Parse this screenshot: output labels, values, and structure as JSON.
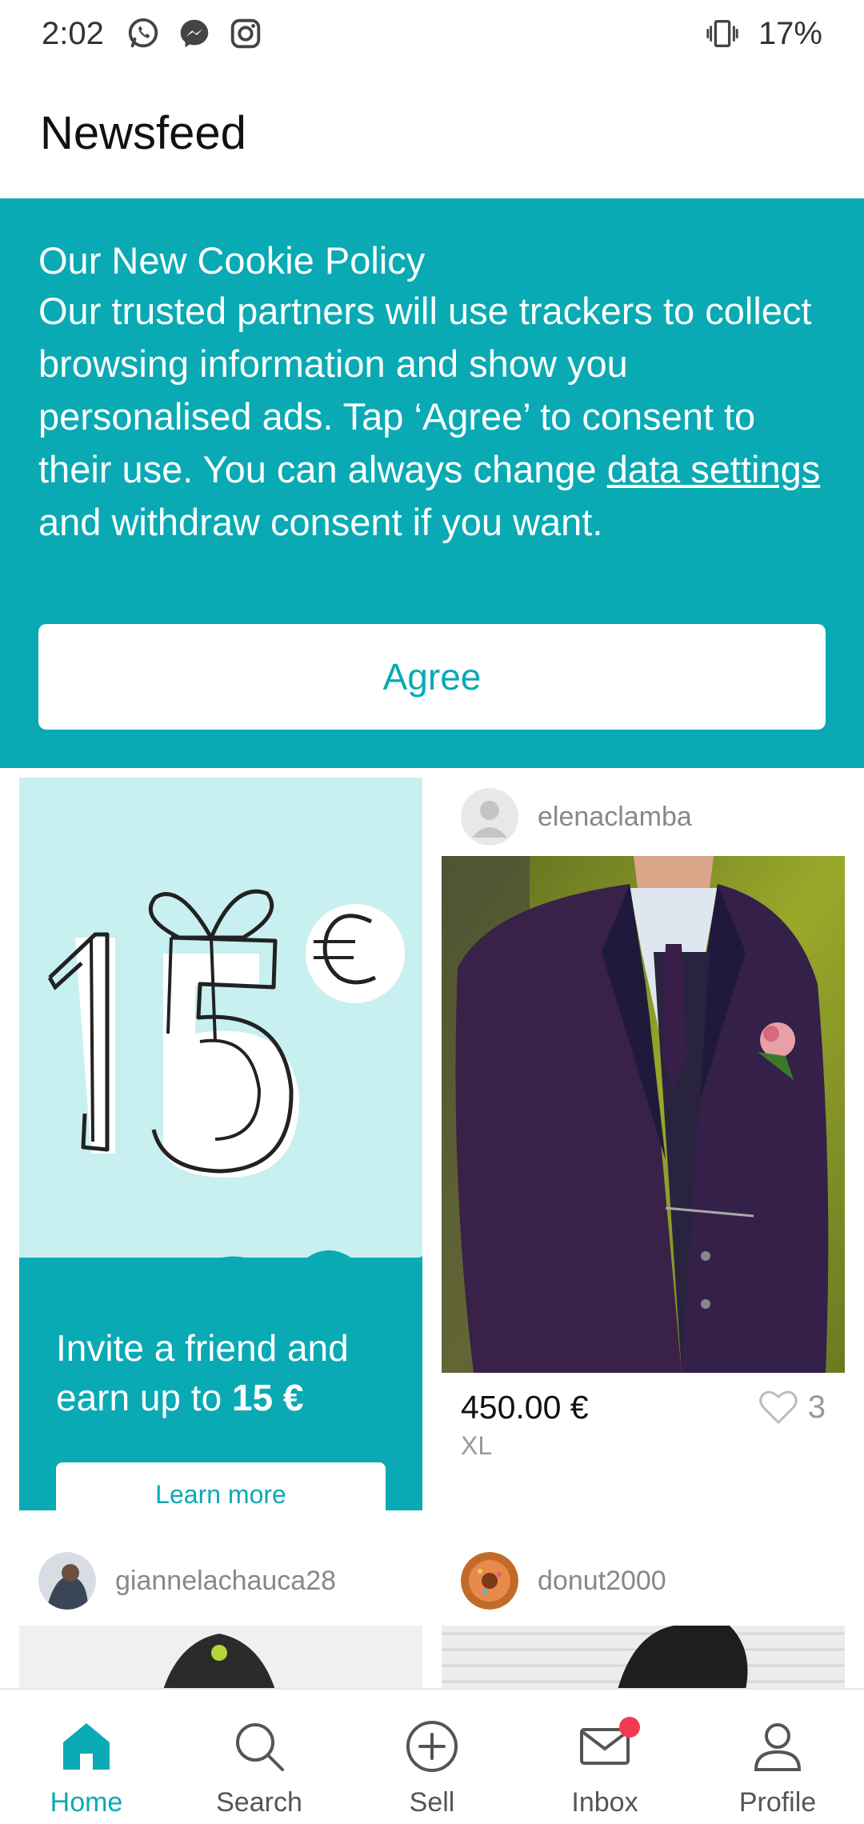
{
  "status_bar": {
    "time": "2:02",
    "battery": "17%",
    "icons": [
      "whatsapp-icon",
      "messenger-icon",
      "instagram-icon",
      "vibrate-icon"
    ]
  },
  "header": {
    "title": "Newsfeed"
  },
  "cookie_banner": {
    "title": "Our New Cookie Policy",
    "body_part1": "Our trusted partners will use trackers to collect browsing information and show you personalised ads. Tap ‘Agree’ to consent to their use. You can always change ",
    "link_text": "data settings",
    "body_part2": " and withdraw consent if you want.",
    "agree_label": "Agree",
    "background_color": "#09aab4"
  },
  "promo": {
    "art_text": "15€",
    "text_part1": "Invite a friend and earn up to ",
    "text_bold": "15 €",
    "button_label": "Learn more"
  },
  "items": [
    {
      "username": "elenaclamba",
      "price": "450.00 €",
      "size": "XL",
      "likes": "3"
    },
    {
      "username": "giannelachauca28"
    },
    {
      "username": "donut2000"
    }
  ],
  "bottom_nav": {
    "items": [
      {
        "label": "Home",
        "icon": "home-icon",
        "active": true
      },
      {
        "label": "Search",
        "icon": "search-icon",
        "active": false
      },
      {
        "label": "Sell",
        "icon": "plus-circle-icon",
        "active": false
      },
      {
        "label": "Inbox",
        "icon": "mail-icon",
        "active": false,
        "badge": true
      },
      {
        "label": "Profile",
        "icon": "profile-icon",
        "active": false
      }
    ],
    "accent_color": "#09aab4"
  }
}
